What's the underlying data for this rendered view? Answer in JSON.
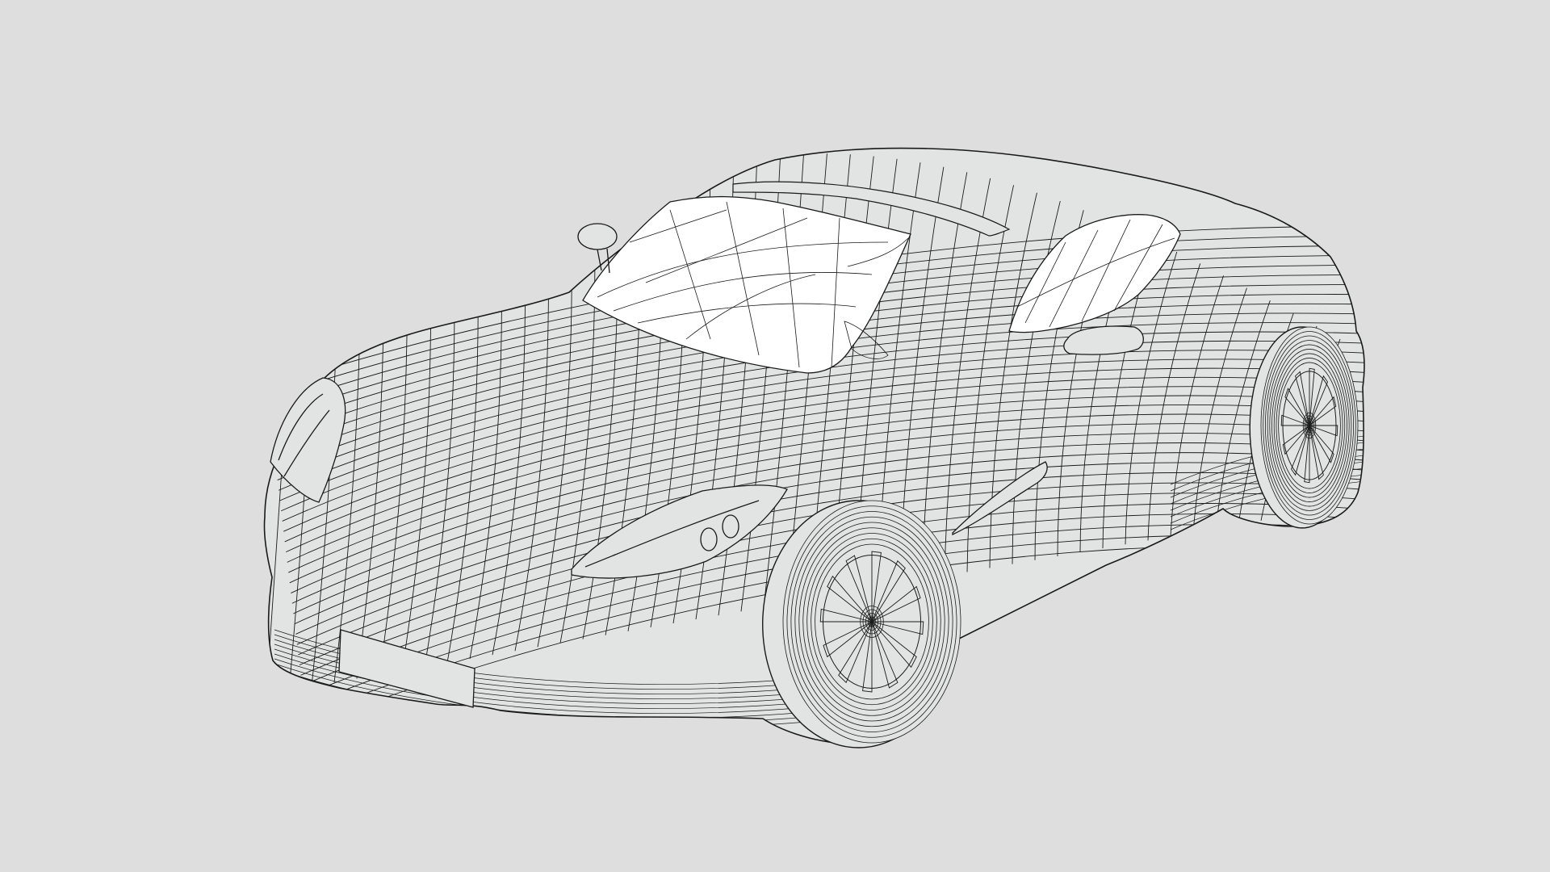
{
  "viewport": {
    "background_color": "#dedede",
    "model": {
      "subject": "car",
      "display_mode": "wireframe",
      "surface_color": "#e1e4e3",
      "glass_color": "#ffffff",
      "edge_color": "#1a1a1a"
    }
  }
}
